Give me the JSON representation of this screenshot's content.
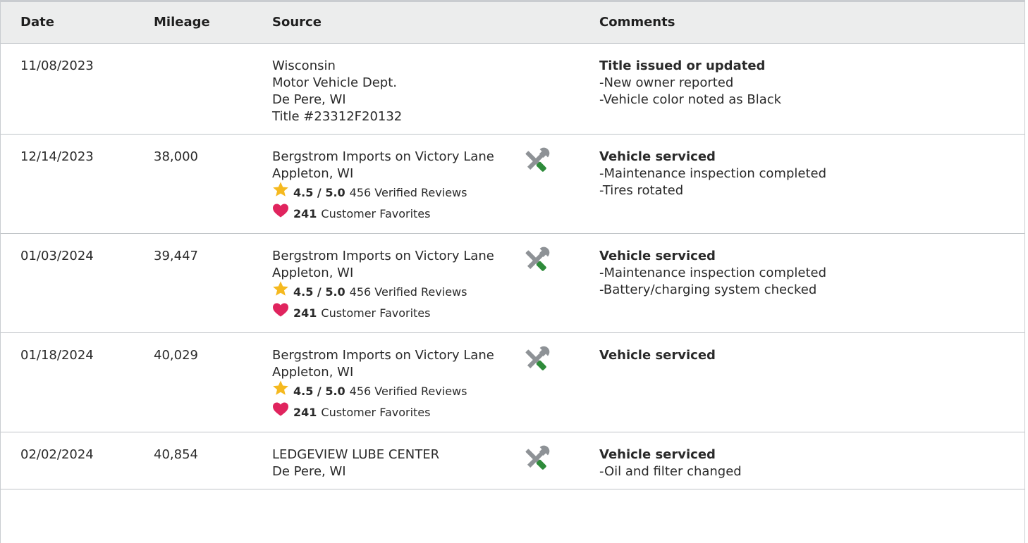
{
  "headers": {
    "date": "Date",
    "mileage": "Mileage",
    "source": "Source",
    "comments": "Comments"
  },
  "rows": [
    {
      "date": "11/08/2023",
      "mileage": "",
      "source": [
        "Wisconsin",
        "Motor Vehicle Dept.",
        "De Pere, WI",
        "Title #23312F20132"
      ],
      "comment_title": "Title issued or updated",
      "comments": [
        "-New owner reported",
        "-Vehicle color noted as Black"
      ]
    },
    {
      "date": "12/14/2023",
      "mileage": "38,000",
      "source": [
        "Bergstrom Imports on Victory Lane",
        "Appleton, WI"
      ],
      "rating": "4.5 / 5.0",
      "reviews": "456 Verified Reviews",
      "favorites_count": "241",
      "favorites_label": "Customer Favorites",
      "comment_title": "Vehicle serviced",
      "comments": [
        "-Maintenance inspection completed",
        "-Tires rotated"
      ]
    },
    {
      "date": "01/03/2024",
      "mileage": "39,447",
      "source": [
        "Bergstrom Imports on Victory Lane",
        "Appleton, WI"
      ],
      "rating": "4.5 / 5.0",
      "reviews": "456 Verified Reviews",
      "favorites_count": "241",
      "favorites_label": "Customer Favorites",
      "comment_title": "Vehicle serviced",
      "comments": [
        "-Maintenance inspection completed",
        "-Battery/charging system checked"
      ]
    },
    {
      "date": "01/18/2024",
      "mileage": "40,029",
      "source": [
        "Bergstrom Imports on Victory Lane",
        "Appleton, WI"
      ],
      "rating": "4.5 / 5.0",
      "reviews": "456 Verified Reviews",
      "favorites_count": "241",
      "favorites_label": "Customer Favorites",
      "comment_title": "Vehicle serviced",
      "comments": []
    },
    {
      "date": "02/02/2024",
      "mileage": "40,854",
      "source": [
        "LEDGEVIEW LUBE CENTER",
        "De Pere, WI"
      ],
      "comment_title": "Vehicle serviced",
      "comments": [
        "-Oil and filter changed"
      ]
    }
  ],
  "icons": {
    "service": "wrench-screwdriver-icon",
    "rating": "star-icon",
    "favorite": "heart-icon"
  },
  "colors": {
    "header_bg": "#eceded",
    "star": "#f5b91f",
    "heart": "#e0245e",
    "tool_gray": "#8e9296",
    "tool_green": "#2e8b3a"
  }
}
